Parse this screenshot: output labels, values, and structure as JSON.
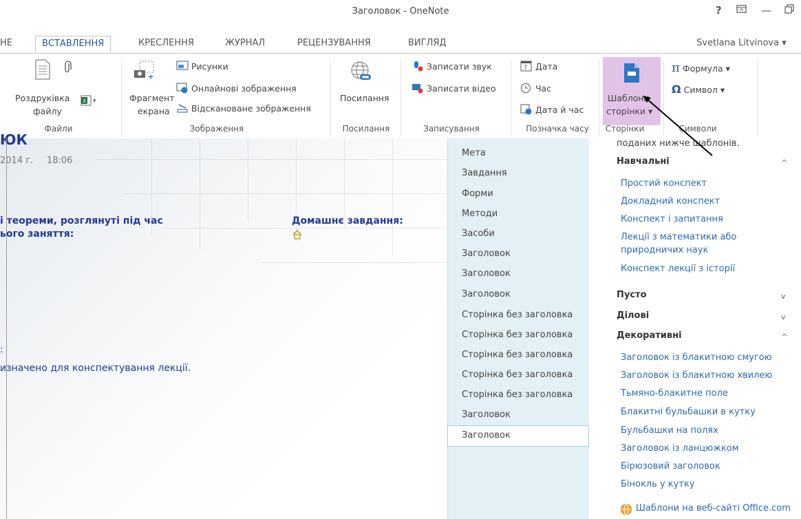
{
  "window": {
    "title": "Заголовок - OneNote",
    "user": "Svetlana Litvinova",
    "help": "?",
    "minimize": "—",
    "restore": "🗗",
    "ribbon_options": "🗖"
  },
  "tabs": [
    {
      "label": "НЕ"
    },
    {
      "label": "ВСТАВЛЕННЯ",
      "active": true
    },
    {
      "label": "КРЕСЛЕННЯ"
    },
    {
      "label": "ЖУРНАЛ"
    },
    {
      "label": "РЕЦЕНЗУВАННЯ"
    },
    {
      "label": "ВИГЛЯД"
    }
  ],
  "ribbon": {
    "files": {
      "printout": "Роздруківка",
      "printout2": "файлу",
      "group": "Файли"
    },
    "images": {
      "screen_clip": "Фрагмент",
      "screen_clip2": "екрана",
      "pictures": "Рисунки",
      "online_pictures": "Онлайнові зображення",
      "scanned": "Відскановане зображення",
      "group": "Зображення"
    },
    "links": {
      "link": "Посилання",
      "group": "Посилання"
    },
    "recording": {
      "audio": "Записати звук",
      "video": "Записати відео",
      "group": "Записування"
    },
    "timestamp": {
      "date": "Дата",
      "time": "Час",
      "date_time": "Дата й час",
      "group": "Позначка часу"
    },
    "pages": {
      "templates": "Шаблони",
      "templates2": "сторінки",
      "group": "Сторінки"
    },
    "symbols": {
      "equation": "Формула",
      "symbol": "Символ",
      "group": "Символи"
    }
  },
  "note": {
    "title_fragment": "ЮК",
    "date": "2014 г.",
    "time": "18:06",
    "heading1_line1": "і теореми, розглянуті під час",
    "heading1_line2": "ього заняття:",
    "homework": "Домашнє завдання:",
    "colon": ":",
    "body": "изначено для конспектування лекції."
  },
  "pages": [
    "Мета",
    "Завдання",
    "Форми",
    "Методи",
    "Засоби",
    "Заголовок",
    "Заголовок",
    "Заголовок",
    "Сторінка без заголовка",
    "Сторінка без заголовка",
    "Сторінка без заголовка",
    "Сторінка без заголовка",
    "Сторінка без заголовка",
    "Заголовок",
    "Заголовок"
  ],
  "templates_pane": {
    "intro": "поданих нижче шаблонів.",
    "categories": [
      {
        "name": "Навчальні",
        "expanded": true,
        "chevron": "^",
        "items": [
          "Простий конспект",
          "Докладний конспект",
          "Конспект і запитання",
          "Лекції з математики або",
          "природничих наук",
          "Конспект лекції з історії"
        ]
      },
      {
        "name": "Пусто",
        "expanded": false,
        "chevron": "v"
      },
      {
        "name": "Ділові",
        "expanded": false,
        "chevron": "v"
      },
      {
        "name": "Декоративні",
        "expanded": true,
        "chevron": "^",
        "items": [
          "Заголовок із блакитною смугою",
          "Заголовок із блакитною хвилею",
          "Тьмяно-блакитне поле",
          "Блакитні бульбашки в кутку",
          "Бульбашки на полях",
          "Заголовок із ланцюжком",
          "Бірюзовий заголовок",
          "Бінокль у кутку"
        ]
      }
    ],
    "office_link": "Шаблони на веб-сайті Office.com"
  },
  "colors": {
    "accent": "#2b579a",
    "highlight": "#e1c3e6",
    "pagelist_bg": "#e3f1f6",
    "link": "#2b6bb0",
    "note_text": "#1f3a93"
  }
}
